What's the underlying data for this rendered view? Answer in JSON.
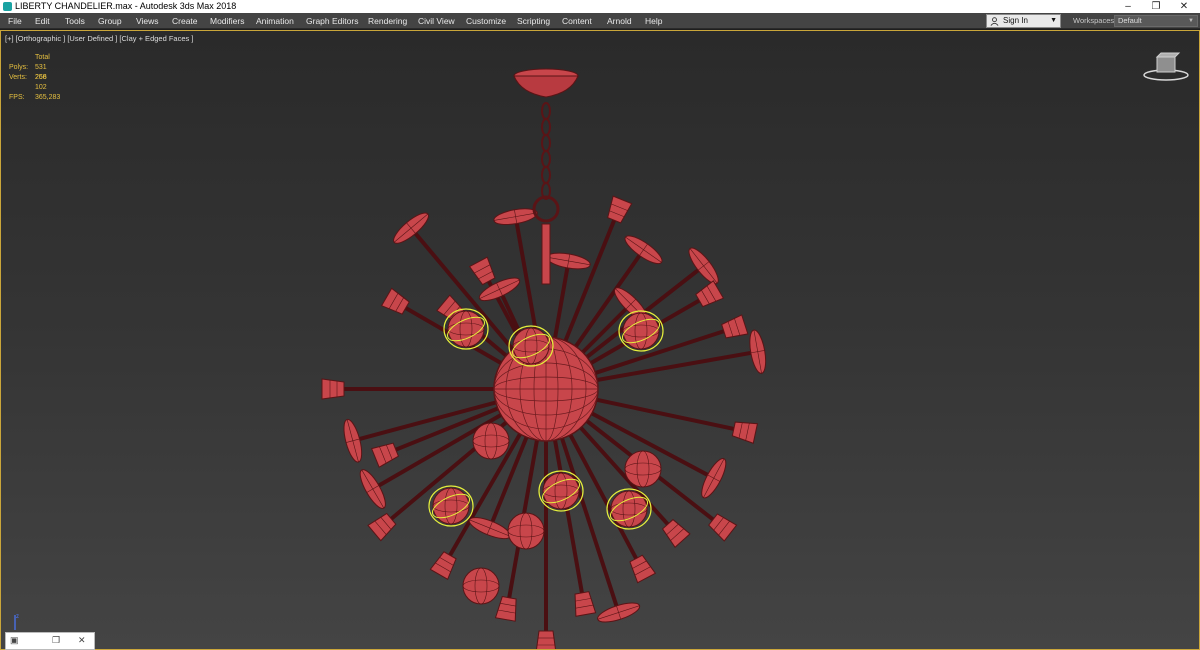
{
  "window": {
    "title": "LIBERTY CHANDELIER.max - Autodesk 3ds Max 2018",
    "controls": [
      "–",
      "❐",
      "✕"
    ]
  },
  "menu": {
    "items": [
      "File",
      "Edit",
      "Tools",
      "Group",
      "Views",
      "Create",
      "Modifiers",
      "Animation",
      "Graph Editors",
      "Rendering",
      "Civil View",
      "Customize",
      "Scripting",
      "Content",
      "Arnold",
      "Help"
    ],
    "sign_in": "Sign In",
    "workspaces_label": "Workspaces:",
    "workspace_value": "Default"
  },
  "viewport": {
    "label": "[+] [Orthographic ] [User Defined ] [Clay + Edged Faces ]",
    "stats": {
      "header": "Total",
      "polys_label": "Polys:",
      "polys_value": "531 256",
      "verts_label": "Verts:",
      "verts_value": "268 102",
      "fps_label": "FPS:",
      "fps_value": "365,283"
    }
  },
  "colors": {
    "model_fill": "#c8464b",
    "model_wire": "#5a1416",
    "selection": "#e6f03c",
    "viewport_border": "#caa63a",
    "stats_text": "#e6c040"
  },
  "mini_panel": {
    "icons": [
      "app-icon",
      "restore-icon",
      "close-icon"
    ]
  }
}
